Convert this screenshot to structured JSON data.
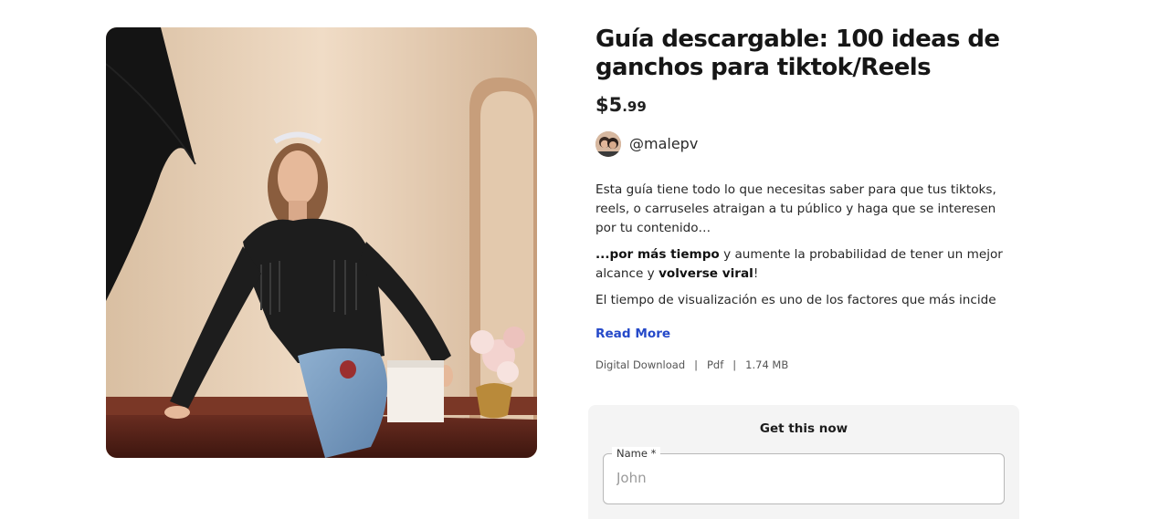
{
  "product": {
    "title": "Guía descargable: 100 ideas de ganchos para tiktok/Reels",
    "price_whole": "$5",
    "price_cents": ".99",
    "image_icon": "product-photo"
  },
  "creator": {
    "handle": "@malepv"
  },
  "description": {
    "p1": "Esta guía tiene todo lo que necesitas saber para que tus tiktoks, reels, o carruseles atraigan a tu público y haga que se interesen por tu contenido…",
    "p2_bold1": "...por más tiempo",
    "p2_text1": " y aumente la probabilidad de tener un mejor alcance y ",
    "p2_bold2": "volverse viral",
    "p2_text2": "!",
    "p3": "El tiempo de visualización es uno de los factores que más incide",
    "read_more": "Read More"
  },
  "meta": {
    "type": "Digital Download",
    "format": "Pdf",
    "size": "1.74 MB",
    "separator": "|"
  },
  "purchase": {
    "card_title": "Get this now",
    "name_label": "Name *",
    "name_placeholder": "John",
    "name_value": ""
  },
  "colors": {
    "link": "#2549c9",
    "card_bg": "#f4f4f4"
  }
}
